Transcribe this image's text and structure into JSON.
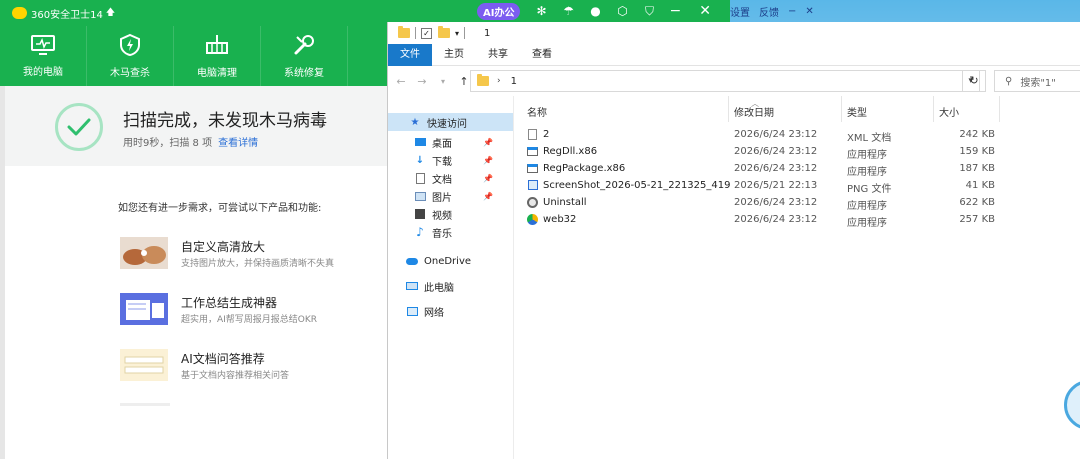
{
  "security_app": {
    "title": "360安全卫士14",
    "nav": [
      {
        "label": "我的电脑",
        "icon": "monitor-icon"
      },
      {
        "label": "木马查杀",
        "icon": "shield-icon"
      },
      {
        "label": "电脑清理",
        "icon": "broom-icon"
      },
      {
        "label": "系统修复",
        "icon": "wrench-icon"
      }
    ],
    "result": {
      "headline": "扫描完成，未发现木马病毒",
      "summary": "用时9秒，扫描 8 项",
      "details_link": "查看详情"
    },
    "more_prompt": "如您还有进一步需求，可尝试以下产品和功能:",
    "products": [
      {
        "name": "自定义高清放大",
        "desc": "支持图片放大，并保持画质清晰不失真"
      },
      {
        "name": "工作总结生成神器",
        "desc": "超实用，AI帮写周报月报总结OKR"
      },
      {
        "name": "AI文档问答推荐",
        "desc": "基于文档内容推荐相关问答"
      }
    ],
    "accent": "#19b14f"
  },
  "floating_toolbar": {
    "ai_label": "AI办公",
    "extra": [
      "设置",
      "反馈"
    ]
  },
  "explorer": {
    "window_title": "1",
    "ribbon_tabs": [
      "文件",
      "主页",
      "共享",
      "查看"
    ],
    "path": "1",
    "search_placeholder": "搜索\"1\"",
    "quick_access": "快速访问",
    "sidebar": [
      {
        "label": "桌面",
        "pinned": true
      },
      {
        "label": "下载",
        "pinned": true
      },
      {
        "label": "文档",
        "pinned": true
      },
      {
        "label": "图片",
        "pinned": true
      },
      {
        "label": "视频",
        "pinned": false
      },
      {
        "label": "音乐",
        "pinned": false
      }
    ],
    "onedrive": "OneDrive",
    "this_pc": "此电脑",
    "network": "网络",
    "columns": [
      "名称",
      "修改日期",
      "类型",
      "大小"
    ],
    "files": [
      {
        "name": "2",
        "date": "2026/6/24 23:12",
        "type": "XML 文档",
        "size": "242 KB",
        "icon": "xml-file-icon"
      },
      {
        "name": "RegDll.x86",
        "date": "2026/6/24 23:12",
        "type": "应用程序",
        "size": "159 KB",
        "icon": "exe-file-icon"
      },
      {
        "name": "RegPackage.x86",
        "date": "2026/6/24 23:12",
        "type": "应用程序",
        "size": "187 KB",
        "icon": "exe-file-icon"
      },
      {
        "name": "ScreenShot_2026-05-21_221325_419",
        "date": "2026/5/21 22:13",
        "type": "PNG 文件",
        "size": "41 KB",
        "icon": "png-file-icon"
      },
      {
        "name": "Uninstall",
        "date": "2026/6/24 23:12",
        "type": "应用程序",
        "size": "622 KB",
        "icon": "uninstall-icon"
      },
      {
        "name": "web32",
        "date": "2026/6/24 23:12",
        "type": "应用程序",
        "size": "257 KB",
        "icon": "web32-icon"
      }
    ],
    "accent": "#1979ca"
  }
}
